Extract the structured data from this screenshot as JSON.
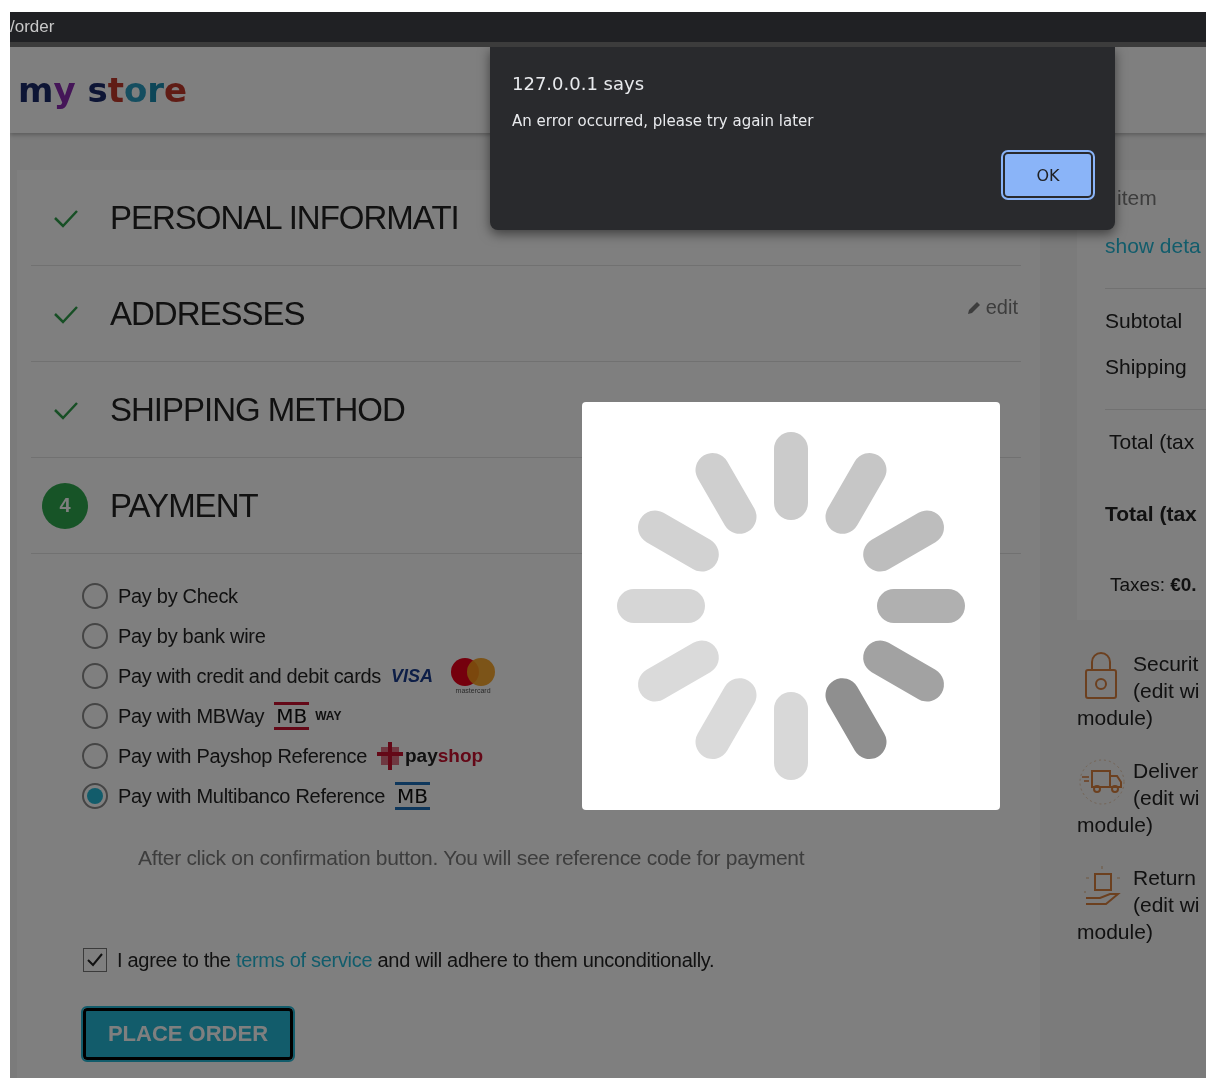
{
  "address_bar": {
    "text": "/order"
  },
  "header": {
    "logo": "my store"
  },
  "steps": [
    {
      "kind": "done",
      "title": "PERSONAL INFORMATI"
    },
    {
      "kind": "done",
      "title": "ADDRESSES",
      "edit": "edit"
    },
    {
      "kind": "done",
      "title": "SHIPPING METHOD"
    },
    {
      "kind": "current",
      "number": "4",
      "title": "PAYMENT"
    }
  ],
  "payment_options": [
    {
      "label": "Pay by Check",
      "selected": false
    },
    {
      "label": "Pay by bank wire",
      "selected": false
    },
    {
      "label": "Pay with credit and debit cards",
      "selected": false,
      "logos": [
        {
          "kind": "visa",
          "text": "VISA"
        },
        {
          "kind": "mastercard",
          "text": "mastercard"
        }
      ]
    },
    {
      "label": "Pay with MBWay",
      "selected": false,
      "logos": [
        {
          "kind": "mbway",
          "text": "MB"
        },
        {
          "kind": "way",
          "text": "WAY"
        }
      ]
    },
    {
      "label": "Pay with Payshop Reference",
      "selected": false,
      "logos": [
        {
          "kind": "payshop",
          "text": "pay",
          "accent": "shop"
        }
      ]
    },
    {
      "label": "Pay with Multibanco Reference",
      "selected": true,
      "logos": [
        {
          "kind": "multibanco",
          "text": "MB"
        }
      ]
    }
  ],
  "payment_note": "After click on confirmation button. You will see reference code for payment",
  "terms": {
    "checked": true,
    "before": "I agree to the ",
    "link": "terms of service",
    "after": " and will adhere to them unconditionally."
  },
  "place_order": {
    "label": "PLACE ORDER"
  },
  "cart_summary": {
    "items_count": "item",
    "details_link": "show deta",
    "lines": [
      {
        "label": "Subtotal"
      },
      {
        "label": "Shipping"
      }
    ],
    "totals": [
      {
        "label": "Total (tax",
        "bold": false
      },
      {
        "label": "Total (tax",
        "bold": true
      }
    ],
    "taxes": "Taxes: **€0.**"
  },
  "reassurance": [
    {
      "kind": "lock",
      "title": "Securit",
      "lines": [
        "(edit wi",
        "module)"
      ]
    },
    {
      "kind": "truck",
      "title": "Deliver",
      "lines": [
        "(edit wi",
        "module)"
      ]
    },
    {
      "kind": "hand",
      "title": "Return",
      "lines": [
        "(edit wi",
        "module)"
      ]
    }
  ],
  "dialog": {
    "title": "127.0.0.1 says",
    "message": "An error occurred, please try again later",
    "button": "OK"
  },
  "loader": {
    "visible": true
  }
}
